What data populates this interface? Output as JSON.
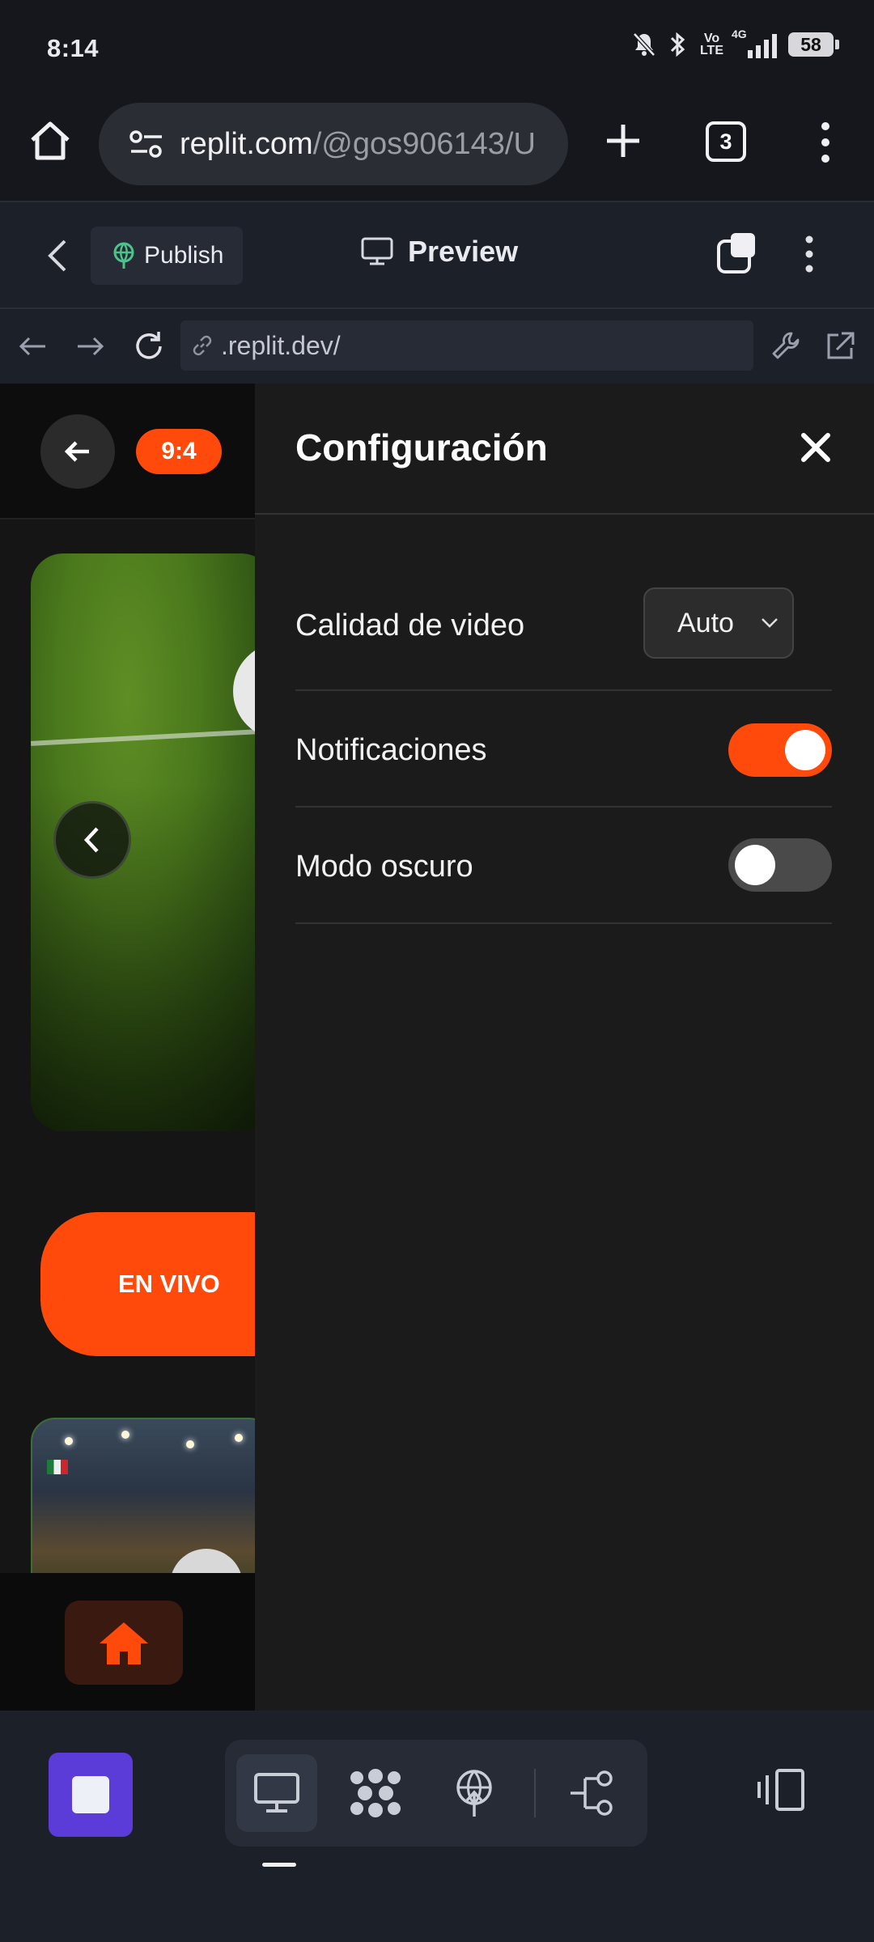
{
  "status_bar": {
    "time": "8:14",
    "network": "4G",
    "volte": "Vo\nLTE",
    "battery": "58",
    "icons": [
      "mute-icon",
      "bluetooth-icon",
      "volte-icon",
      "signal-icon",
      "battery-icon"
    ]
  },
  "browser": {
    "url_host": "replit.com",
    "url_path": "/@gos906143/U",
    "tab_count": "3",
    "icons": [
      "home-icon",
      "site-settings-icon",
      "new-tab-icon",
      "tabs-icon",
      "more-vert-icon"
    ]
  },
  "replit_header": {
    "publish_label": "Publish",
    "preview_label": "Preview",
    "icons": [
      "back-icon",
      "publish-icon",
      "monitor-icon",
      "copy-icon",
      "more-vert-icon"
    ]
  },
  "webview_nav": {
    "address": ".replit.dev/",
    "icons": [
      "nav-back-icon",
      "nav-forward-icon",
      "reload-icon",
      "link-icon",
      "wrench-icon",
      "external-link-icon"
    ]
  },
  "app": {
    "score": "9:4",
    "live_label": "EN VIVO",
    "icons": [
      "arrow-left-icon",
      "chevron-left-icon",
      "home-icon"
    ]
  },
  "settings": {
    "title": "Configuración",
    "rows": [
      {
        "label": "Calidad de video",
        "control": "select",
        "value": "Auto"
      },
      {
        "label": "Notificaciones",
        "control": "toggle",
        "value": true
      },
      {
        "label": "Modo oscuro",
        "control": "toggle",
        "value": false
      }
    ]
  },
  "colors": {
    "accent": "#ff4a0c",
    "panel_bg": "#1b1b1b",
    "toggle_off": "#4a4a4a",
    "replit_bar": "#1c2029",
    "stop_button": "#5b3cd8"
  },
  "bottom_bar": {
    "icons": [
      "stop-icon",
      "preview-monitor-icon",
      "agent-icon",
      "deploy-icon",
      "git-icon",
      "panel-toggle-icon"
    ]
  }
}
